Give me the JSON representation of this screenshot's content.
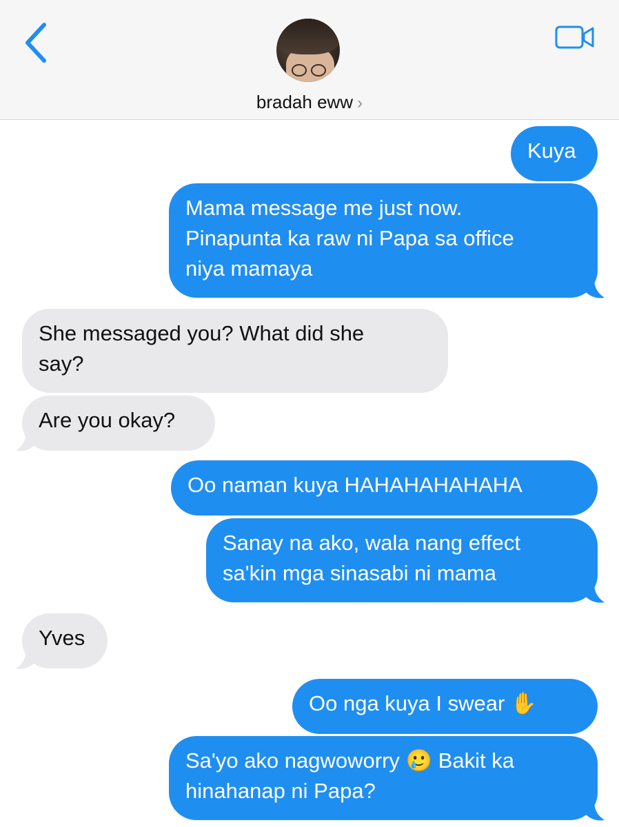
{
  "header": {
    "contact_name": "bradah eww",
    "chevron": "›"
  },
  "icons": {
    "back": "chevron-left-icon",
    "video": "video-camera-icon",
    "avatar": "contact-avatar"
  },
  "colors": {
    "accent": "#1f8ef1",
    "received_bubble": "#e9e9eb",
    "header_bg": "#f6f6f6"
  },
  "messages": [
    {
      "from": "me",
      "text": "Kuya"
    },
    {
      "from": "me",
      "lines": [
        "Mama message me just now.",
        "Pinapunta ka raw ni Papa sa office",
        "niya mamaya"
      ]
    },
    {
      "from": "them",
      "lines": [
        "She messaged you? What did she",
        "say?"
      ]
    },
    {
      "from": "them",
      "text": "Are you okay?"
    },
    {
      "from": "me",
      "text": "Oo naman kuya HAHAHAHAHAHA"
    },
    {
      "from": "me",
      "lines": [
        "Sanay na ako, wala nang effect",
        "sa'kin mga sinasabi ni mama"
      ]
    },
    {
      "from": "them",
      "text": "Yves"
    },
    {
      "from": "me",
      "text": "Oo nga kuya I swear ✋"
    },
    {
      "from": "me",
      "lines": [
        "Sa'yo ako nagwoworry 🥲 Bakit ka",
        "hinahanap ni Papa?"
      ]
    }
  ]
}
